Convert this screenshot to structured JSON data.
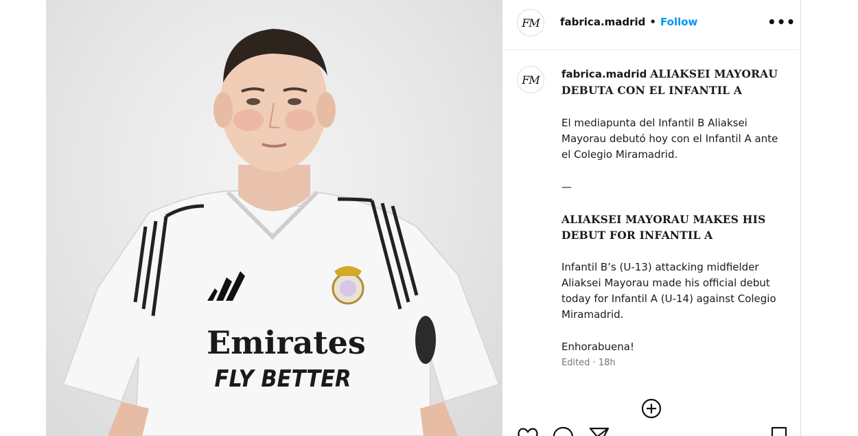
{
  "post": {
    "image_alt": "Youth player in white Real Madrid home shirt",
    "shirt_sponsor_line1": "Emirates",
    "shirt_sponsor_line2": "FLY BETTER"
  },
  "header": {
    "username": "fabrica.madrid",
    "separator": "•",
    "follow_label": "Follow",
    "more_label": "•••",
    "avatar_text": "FM"
  },
  "caption": {
    "username": "fabrica.madrid",
    "title_es": "ALIAKSEI MAYORAU DEBUTA CON EL INFANTIL A",
    "body_es": "El mediapunta del Infantil B Aliaksei Mayorau debutó hoy con el Infantil A ante el Colegio Miramadrid.",
    "divider": "—",
    "title_en": "ALIAKSEI MAYORAU MAKES HIS DEBUT FOR INFANTIL A",
    "body_en": "Infantil B’s (U-13) attacking midfielder Aliaksei Mayorau made his official debut today for Infantil A (U-14) against Colegio Miramadrid.",
    "closing": "Enhorabuena!",
    "meta": "Edited · 18h"
  },
  "icons": {
    "more": "more-options-icon",
    "add_comment": "plus-circle-icon",
    "like": "heart-icon",
    "comment": "comment-icon",
    "share": "send-icon",
    "save": "bookmark-icon"
  }
}
